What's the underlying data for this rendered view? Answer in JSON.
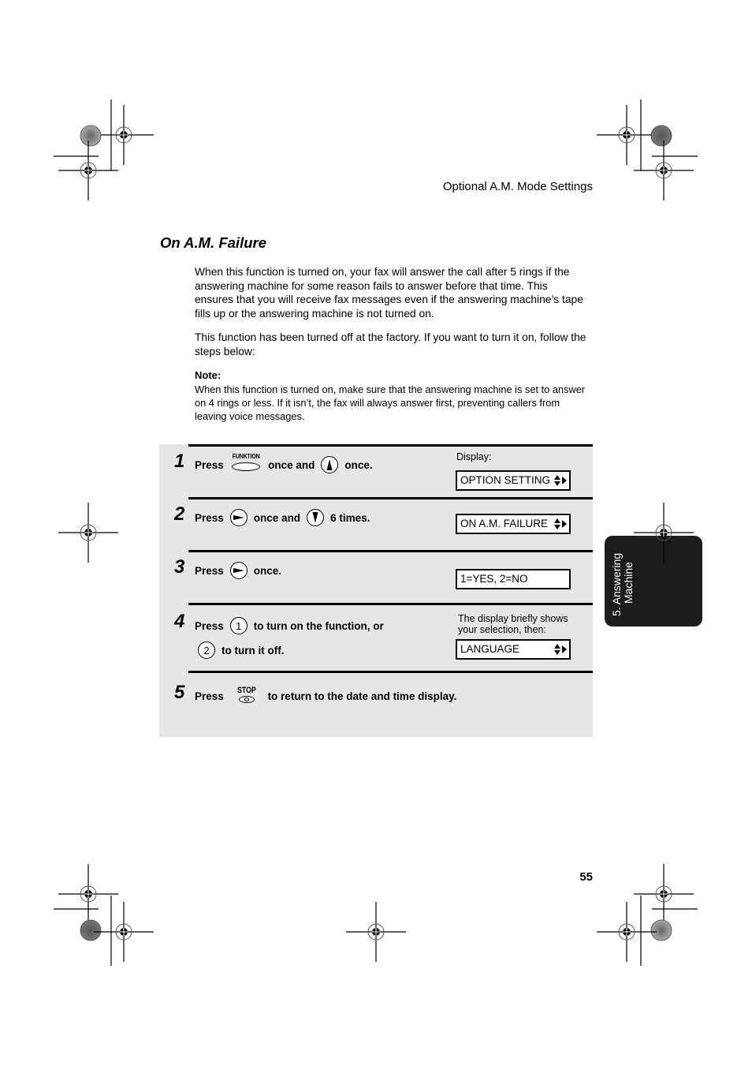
{
  "header": {
    "title": "Optional A.M. Mode Settings"
  },
  "section": {
    "title": "On A.M. Failure"
  },
  "paragraphs": [
    "When this function is turned on, your fax will answer the call after 5 rings if the answering machine for some reason fails to answer before that time. This ensures that you will receive fax messages even if the answering machine’s tape fills up or the answering machine is not turned on.",
    "This function has been turned off at the factory. If you want to turn it on, follow the steps below:"
  ],
  "note": {
    "label": "Note:",
    "text": "When this function is turned on, make sure that the answering machine is set to answer on 4 rings or less. If it isn’t, the fax will always answer first, preventing callers from leaving voice messages."
  },
  "steps": [
    {
      "number": "1",
      "press": "Press",
      "key1": "FUNKTION",
      "mid": "once and",
      "key2_icon": "up-arrow-key-icon",
      "end": "once.",
      "display_label": "Display:",
      "display": "OPTION SETTING"
    },
    {
      "number": "2",
      "press": "Press",
      "key1_icon": "right-arrow-key-icon",
      "mid": "once and",
      "key2_icon": "down-arrow-key-icon",
      "end": "6 times.",
      "display": "ON A.M. FAILURE"
    },
    {
      "number": "3",
      "press": "Press",
      "key1_icon": "right-arrow-key-icon",
      "end": "once.",
      "display": "1=YES, 2=NO"
    },
    {
      "number": "4",
      "press": "Press",
      "key1": "1",
      "line1_end": "to turn on the function, or",
      "key2": "2",
      "line2_end": "to turn it off.",
      "display_label": "The display briefly shows your selection, then:",
      "display": "LANGUAGE"
    },
    {
      "number": "5",
      "press": "Press",
      "key1": "STOP",
      "end": "to return to the date and time display."
    }
  ],
  "side_tab": {
    "line1": "5. Answering",
    "line2": "Machine"
  },
  "footer": {
    "page_number": "55"
  },
  "colors": {
    "steps_background": "#e6e6e6",
    "side_tab": "#1c1c1c"
  }
}
